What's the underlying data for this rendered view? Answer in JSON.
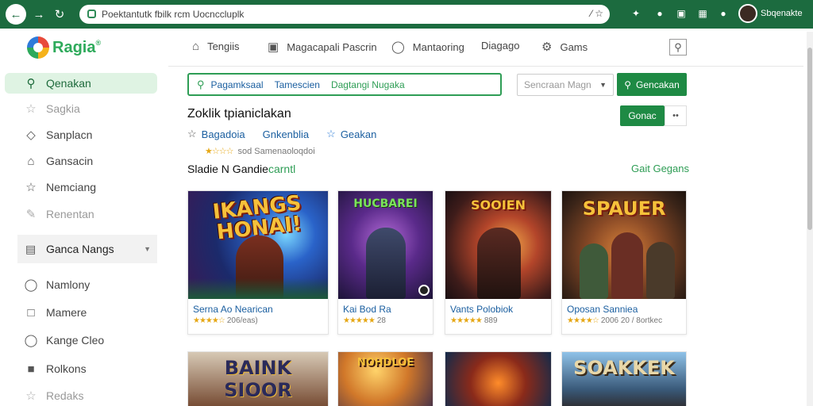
{
  "browser": {
    "url": "Poektantutk fbilk rcm Uocnccluplk",
    "profile_name": "Sbqenakte"
  },
  "logo": {
    "text": "Ragia"
  },
  "sidebar": {
    "items": [
      {
        "label": "Qenakan",
        "icon": "search-icon"
      },
      {
        "label": "Sagkia",
        "icon": "star-icon"
      },
      {
        "label": "Sanplacn",
        "icon": "diamond-icon"
      },
      {
        "label": "Gansacin",
        "icon": "home-icon"
      },
      {
        "label": "Nemciang",
        "icon": "star-outline-icon"
      },
      {
        "label": "Renentan",
        "icon": "pencil-icon"
      }
    ],
    "group": {
      "label": "Ganca Nangs",
      "icon": "list-icon"
    },
    "lower_items": [
      {
        "label": "Namlony",
        "icon": "shield-icon"
      },
      {
        "label": "Mamere",
        "icon": "chat-icon"
      },
      {
        "label": "Kange Cleo",
        "icon": "message-icon"
      },
      {
        "label": "Rolkons",
        "icon": "bag-icon"
      },
      {
        "label": "Redaks",
        "icon": "star-icon"
      }
    ]
  },
  "topnav": {
    "items": [
      {
        "label": "Tengiis",
        "icon": "home-icon"
      },
      {
        "label": "Magacapali Pascrin",
        "icon": "bookmark-icon"
      },
      {
        "label": "Mantaoring",
        "icon": "chat-icon"
      },
      {
        "label": "Diagago",
        "icon": ""
      },
      {
        "label": "Gams",
        "icon": "gear-icon"
      }
    ]
  },
  "search": {
    "query_part1": "Pagamksaal",
    "query_part2": "Tamescien",
    "query_part3": "Dagtangi Nugaka",
    "sort_placeholder": "Sencraan Magn",
    "button_label": "Gencakan"
  },
  "section": {
    "title": "Zoklik tpianiclakan",
    "green_button": "Gonac",
    "more_button": "••"
  },
  "filters": [
    {
      "label": "Bagadoia",
      "icon": "star-icon"
    },
    {
      "label": "Gnkenblia",
      "icon": ""
    },
    {
      "label": "Geakan",
      "icon": "star-blue-icon"
    }
  ],
  "rating_line": {
    "stars": "★☆☆☆",
    "text": "sod Samenaoloqdoi"
  },
  "list_header": {
    "title": "Sladie N Gandie",
    "highlight": "carntl",
    "all_link": "Gait Gegans"
  },
  "games": [
    {
      "art_title": "IKANGS HONAI!",
      "caption": "Serna Ao Nearican",
      "stars": "★★★★☆",
      "meta": "206/eas)"
    },
    {
      "art_title": "HUCBAREI",
      "caption": "Kai Bod Ra",
      "stars": "★★★★★",
      "meta": "28"
    },
    {
      "art_title": "SOOIEN",
      "caption": "Vants Polobiok",
      "stars": "★★★★★",
      "meta": "889"
    },
    {
      "art_title": "SPAUER",
      "caption": "Oposan Sanniea",
      "stars": "★★★★☆",
      "meta": "2006 20 / 8ortkec"
    }
  ],
  "games_row2": [
    {
      "art_title": "BAINK SIOOR"
    },
    {
      "art_title": "NOHDLOE"
    },
    {
      "art_title": ""
    },
    {
      "art_title": "SOAKKEK"
    }
  ],
  "colors": {
    "brand_green": "#1e8a44",
    "chrome_green": "#1c6b3f",
    "link_blue": "#1b5fa0",
    "star": "#e6a817"
  }
}
